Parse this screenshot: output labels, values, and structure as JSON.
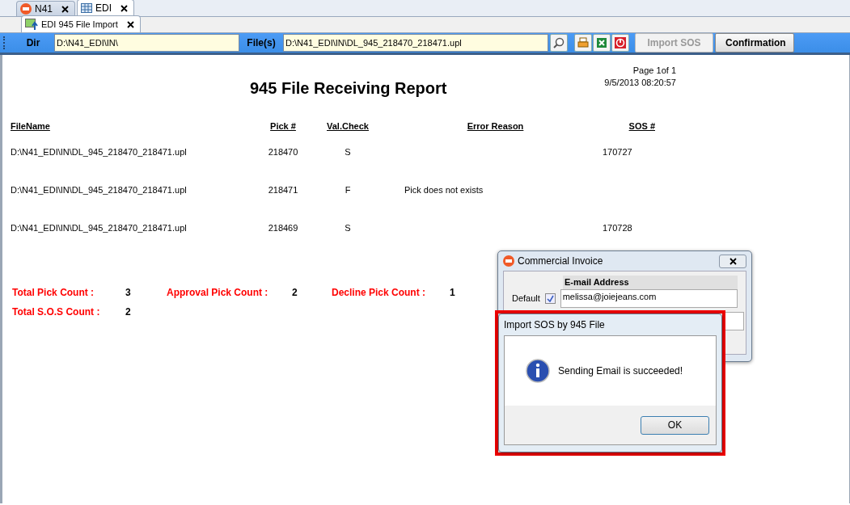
{
  "tabs": [
    {
      "label": "N41",
      "kind": "logo",
      "selected": false
    },
    {
      "label": "EDI",
      "kind": "grid",
      "selected": true
    }
  ],
  "subtabs": [
    {
      "label": "EDI 945 File Import",
      "selected": true
    }
  ],
  "toolbar": {
    "dir_label": "Dir",
    "dir_value": "D:\\N41_EDI\\IN\\",
    "files_label": "File(s)",
    "files_value": "D:\\N41_EDI\\IN\\DL_945_218470_218471.upl",
    "buttons": [
      {
        "label": "Import SOS",
        "disabled": true
      },
      {
        "label": "Confirmation",
        "disabled": false
      }
    ]
  },
  "report": {
    "title": "945 File Receiving Report",
    "page": "Page 1of 1",
    "timestamp": "9/5/2013 08:20:57",
    "columns": [
      "FileName",
      "Pick #",
      "Val.Check",
      "Error Reason",
      "SOS #"
    ],
    "rows": [
      {
        "file": "D:\\N41_EDI\\IN\\DL_945_218470_218471.upl",
        "pick": "218470",
        "check": "S",
        "error": "",
        "sos": "170727"
      },
      {
        "file": "D:\\N41_EDI\\IN\\DL_945_218470_218471.upl",
        "pick": "218471",
        "check": "F",
        "error": "Pick does not exists",
        "sos": ""
      },
      {
        "file": "D:\\N41_EDI\\IN\\DL_945_218470_218471.upl",
        "pick": "218469",
        "check": "S",
        "error": "",
        "sos": "170728"
      }
    ],
    "summary": [
      [
        {
          "label": "Total Pick Count :",
          "value": "3"
        },
        {
          "label": "Approval Pick Count :",
          "value": "2"
        },
        {
          "label": "Decline Pick Count :",
          "value": "1"
        }
      ],
      [
        {
          "label": "Total S.O.S Count :",
          "value": "2"
        }
      ]
    ]
  },
  "invoice_window": {
    "title": "Commercial Invoice",
    "column_header": "E-mail Address",
    "rows": [
      {
        "label": "Default",
        "checked": true,
        "email": "melissa@joiejeans.com"
      }
    ]
  },
  "message_box": {
    "title": "Import SOS by 945 File",
    "message": "Sending Email is succeeded!",
    "button": "OK"
  }
}
